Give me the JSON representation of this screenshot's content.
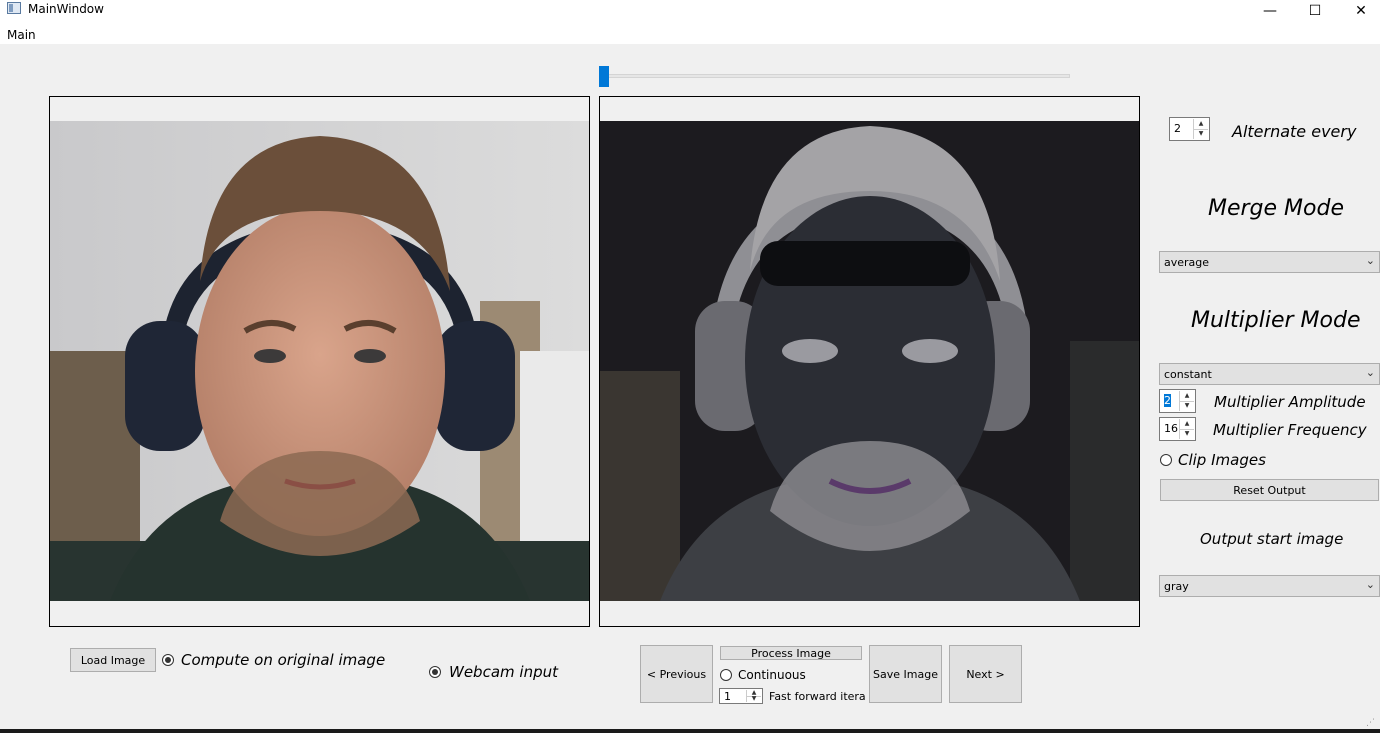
{
  "window": {
    "title": "MainWindow",
    "minimize": "—",
    "maximize": "☐",
    "close": "✕"
  },
  "menu": {
    "main": "Main"
  },
  "controls": {
    "alternate_every": {
      "value": "2",
      "label": "Alternate every"
    },
    "merge_mode": {
      "title": "Merge Mode",
      "selected": "average"
    },
    "multiplier_mode": {
      "title": "Multiplier Mode",
      "selected": "constant"
    },
    "multiplier_amplitude": {
      "value": "2",
      "label": "Multiplier Amplitude"
    },
    "multiplier_frequency": {
      "value": "16",
      "label": "Multiplier Frequency"
    },
    "clip_images": {
      "label": "Clip Images",
      "checked": false
    },
    "reset_output": "Reset Output",
    "output_start_image": {
      "title": "Output start image",
      "selected": "gray"
    }
  },
  "bottom": {
    "load_image": "Load Image",
    "compute_on_original": {
      "label": "Compute on original image",
      "checked": true
    },
    "webcam_input": {
      "label": "Webcam input",
      "checked": true
    },
    "previous": "< Previous",
    "process_image": "Process Image",
    "continuous": {
      "label": "Continuous",
      "checked": false
    },
    "fast_forward": {
      "value": "1",
      "label": "Fast forward iterat"
    },
    "save_image": "Save Image",
    "next": "Next >"
  },
  "slider": {
    "value_fraction": 0.0
  },
  "colors": {
    "accent": "#0078d7"
  }
}
